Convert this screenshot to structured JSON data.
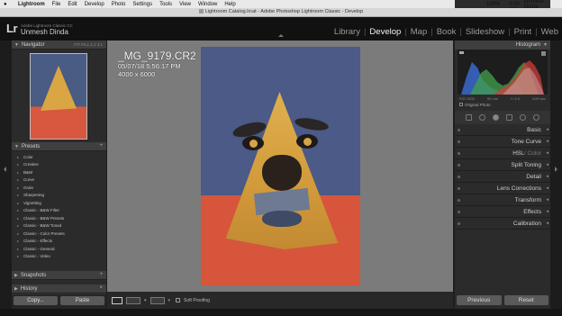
{
  "menubar": {
    "app_name": "Lightroom",
    "items": [
      "File",
      "Edit",
      "Develop",
      "Photo",
      "Settings",
      "Tools",
      "View",
      "Window",
      "Help"
    ],
    "status": {
      "battery": "100%",
      "clock": "Fri 9:59 AM",
      "user": "Unmesh Dinda"
    }
  },
  "window": {
    "title": "Lightroom Catalog.lrcat - Adobe Photoshop Lightroom Classic - Develop"
  },
  "identity": {
    "logo": "Lr",
    "app_label": "Adobe Lightroom Classic CC",
    "user_name": "Unmesh Dinda",
    "modules": [
      {
        "label": "Library",
        "active": false
      },
      {
        "label": "Develop",
        "active": true
      },
      {
        "label": "Map",
        "active": false
      },
      {
        "label": "Book",
        "active": false
      },
      {
        "label": "Slideshow",
        "active": false
      },
      {
        "label": "Print",
        "active": false
      },
      {
        "label": "Web",
        "active": false
      }
    ]
  },
  "left_panel": {
    "navigator": {
      "title": "Navigator",
      "zoom_options": "FIT  FILL  1:1  3:1"
    },
    "presets": {
      "title": "Presets",
      "items": [
        "Color",
        "Creative",
        "B&W",
        "Curve",
        "Grain",
        "Sharpening",
        "Vignetting",
        "Classic - B&W Filter",
        "Classic - B&W Presets",
        "Classic - B&W Toned",
        "Classic - Color Presets",
        "Classic - Effects",
        "Classic - General",
        "Classic - Video"
      ]
    },
    "snapshots": {
      "title": "Snapshots"
    },
    "history": {
      "title": "History"
    },
    "buttons": {
      "copy": "Copy...",
      "paste": "Paste"
    }
  },
  "photo_info": {
    "filename": "_MG_9179.CR2",
    "datetime": "05/07/18 5:56:17 PM",
    "dimensions": "4000 x 6000"
  },
  "toolbar": {
    "soft_proofing": "Soft Proofing"
  },
  "right_panel": {
    "histogram": {
      "title": "Histogram",
      "exif": [
        "ISO 1600",
        "50 mm",
        "f / 4.0",
        "1/25 sec"
      ],
      "original_photo": "Original Photo"
    },
    "sections": [
      {
        "label": "Basic"
      },
      {
        "label": "Tone Curve"
      },
      {
        "label": "HSL",
        "extra": " / Color"
      },
      {
        "label": "Split Toning"
      },
      {
        "label": "Detail"
      },
      {
        "label": "Lens Corrections"
      },
      {
        "label": "Transform"
      },
      {
        "label": "Effects"
      },
      {
        "label": "Calibration"
      }
    ],
    "buttons": {
      "previous": "Previous",
      "reset": "Reset"
    }
  },
  "colors": {
    "background": "#7b7b7b",
    "panel": "#2b2b2b",
    "active_module": "#f2f2f2"
  }
}
